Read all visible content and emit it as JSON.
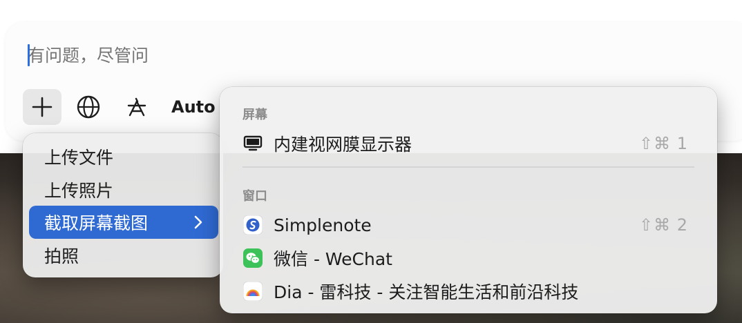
{
  "composer": {
    "placeholder": "有问题，尽管问",
    "auto_label": "Auto"
  },
  "icons": {
    "plus": "plus-icon",
    "globe": "globe-icon",
    "translate": "translate-icon",
    "display": "display-icon",
    "simplenote": "simplenote-app-icon",
    "wechat": "wechat-app-icon",
    "dia": "dia-app-icon",
    "chevron": "chevron-right-icon"
  },
  "menu": {
    "items": [
      {
        "label": "上传文件"
      },
      {
        "label": "上传照片"
      },
      {
        "label": "截取屏幕截图",
        "selected": true
      },
      {
        "label": "拍照"
      }
    ]
  },
  "submenu": {
    "screen_header": "屏幕",
    "window_header": "窗口",
    "screens": [
      {
        "label": "内建视网膜显示器",
        "shortcut": "⇧⌘ 1"
      }
    ],
    "windows": [
      {
        "label": "Simplenote",
        "shortcut": "⇧⌘ 2"
      },
      {
        "label": "微信 - WeChat",
        "shortcut": ""
      },
      {
        "label": "Dia - 雷科技 - 关注智能生活和前沿科技",
        "shortcut": ""
      }
    ]
  },
  "colors": {
    "selection": "#2f6ad3",
    "caret": "#2a6ee0",
    "simplenote": "#3361cc",
    "wechat": "#3dc25a"
  }
}
